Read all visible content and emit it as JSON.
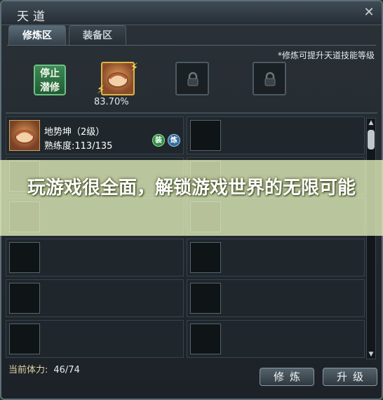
{
  "window": {
    "title": "天道",
    "close_icon": "close-icon"
  },
  "tabs": [
    {
      "label": "修炼区",
      "active": true
    },
    {
      "label": "装备区",
      "active": false
    }
  ],
  "hint": "*修炼可提升天道技能等级",
  "stop_button": {
    "label_line1": "停止",
    "label_line2": "潜修"
  },
  "top_slots": {
    "skill_progress": "83.70%",
    "locked_icon": "lock-icon"
  },
  "skill_list": [
    {
      "name": "地势坤（2级）",
      "proficiency": "熟练度:113/135",
      "badge_equip": "装",
      "badge_practice": "炼"
    }
  ],
  "overlay": {
    "text": "玩游戏很全面，解锁游戏世界的无限可能"
  },
  "footer": {
    "stamina_label": "当前体力:",
    "stamina_value": "46/74",
    "practice_button": "修炼",
    "upgrade_button": "升级"
  },
  "colors": {
    "accent_green": "#2f8c45",
    "overlay": "#e6f2be",
    "skill_border": "#d9b54a"
  }
}
